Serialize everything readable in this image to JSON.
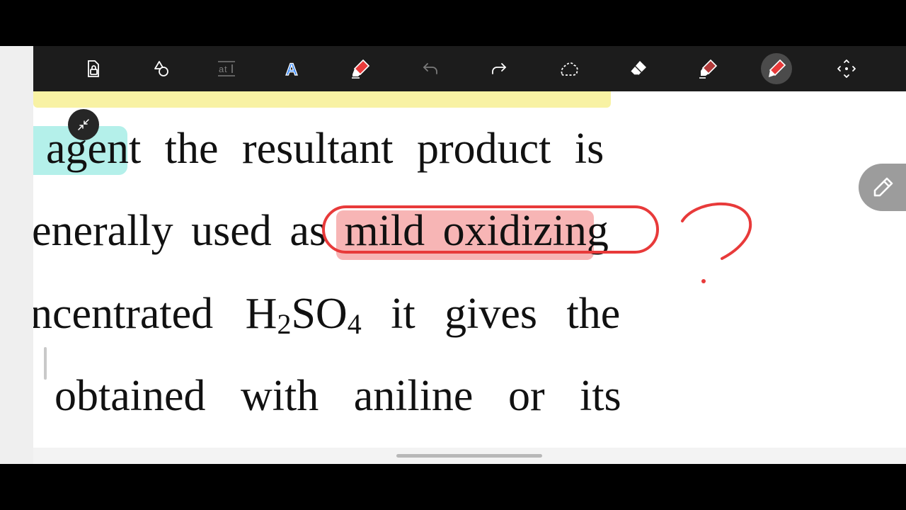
{
  "toolbar": {
    "tools": [
      {
        "icon": "lock-page-icon",
        "name": "lock-tool"
      },
      {
        "icon": "shapes-icon",
        "name": "shapes-tool"
      },
      {
        "icon": "text-select-icon",
        "name": "text-select-tool"
      },
      {
        "icon": "text-icon",
        "name": "text-tool"
      },
      {
        "icon": "highlighter-icon",
        "name": "highlighter-tool"
      },
      {
        "icon": "undo-icon",
        "name": "undo-tool"
      },
      {
        "icon": "redo-icon",
        "name": "redo-tool"
      },
      {
        "icon": "lasso-icon",
        "name": "lasso-tool"
      },
      {
        "icon": "eraser-icon",
        "name": "eraser-tool"
      },
      {
        "icon": "marker-icon",
        "name": "marker-tool"
      },
      {
        "icon": "pen-icon",
        "name": "pen-tool",
        "active": true
      },
      {
        "icon": "move-icon",
        "name": "move-tool"
      }
    ],
    "colors": {
      "accent_red": "#e83a3a",
      "disabled_gray": "#7a7a7a",
      "bar_bg": "#1c1c1c"
    }
  },
  "document": {
    "lines": [
      {
        "words": [
          "agent",
          "the",
          "resultant",
          "product",
          "is"
        ]
      },
      {
        "words": [
          "enerally",
          "used",
          "as",
          "mild",
          "oxidizing"
        ]
      },
      {
        "words": [
          "ncentrated",
          "H",
          "2",
          "SO",
          "4",
          "it",
          "gives",
          "the"
        ]
      },
      {
        "words": [
          "obtained",
          "with",
          "aniline",
          "or",
          "its"
        ]
      }
    ],
    "highlight_colors": {
      "yellow": "#f8f2a4",
      "cyan": "#b4f0ea",
      "pink": "#f7b5b5"
    }
  },
  "annotations": {
    "ink_color": "#e83a3a",
    "shapes": [
      "ellipse-around-mild-oxidizing",
      "question-mark"
    ]
  },
  "floating": {
    "collapse_icon": "collapse-arrows-icon",
    "edit_icon": "pencil-icon"
  }
}
